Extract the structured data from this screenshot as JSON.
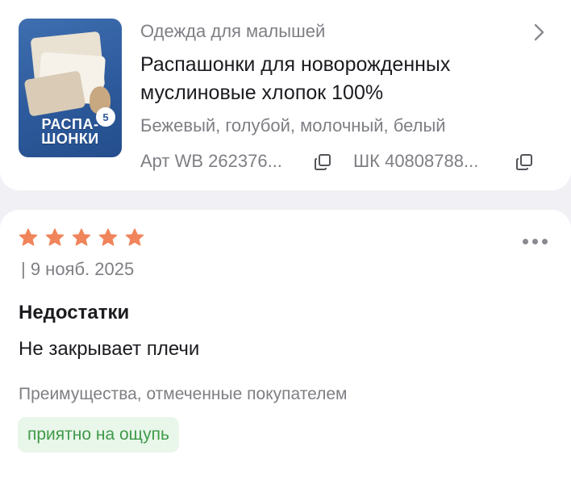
{
  "product": {
    "image_lines": [
      "РАСПА-",
      "ШОНКИ"
    ],
    "image_badge": "5",
    "category": "Одежда для малышей",
    "title": "Распашонки для новорожденных муслиновые хлопок 100%",
    "colors": "Бежевый, голубой, молочный, белый",
    "art": "Арт WB 262376...",
    "shk": "ШК 40808788..."
  },
  "review": {
    "rating": 5,
    "date": "| 9 нояб. 2025",
    "drawbacks_heading": "Недостатки",
    "drawbacks_text": "Не закрывает плечи",
    "advantages_heading": "Преимущества, отмеченные покупателем",
    "tags": [
      "приятно на ощупь"
    ]
  },
  "colors": {
    "star": "#f0845a",
    "tag_bg": "#e9f6ea",
    "tag_text": "#3f9a4a",
    "muted_text": "#7f7e84"
  },
  "icons": [
    "chevron-right-icon",
    "copy-icon",
    "star-icon",
    "more-dots-icon"
  ]
}
